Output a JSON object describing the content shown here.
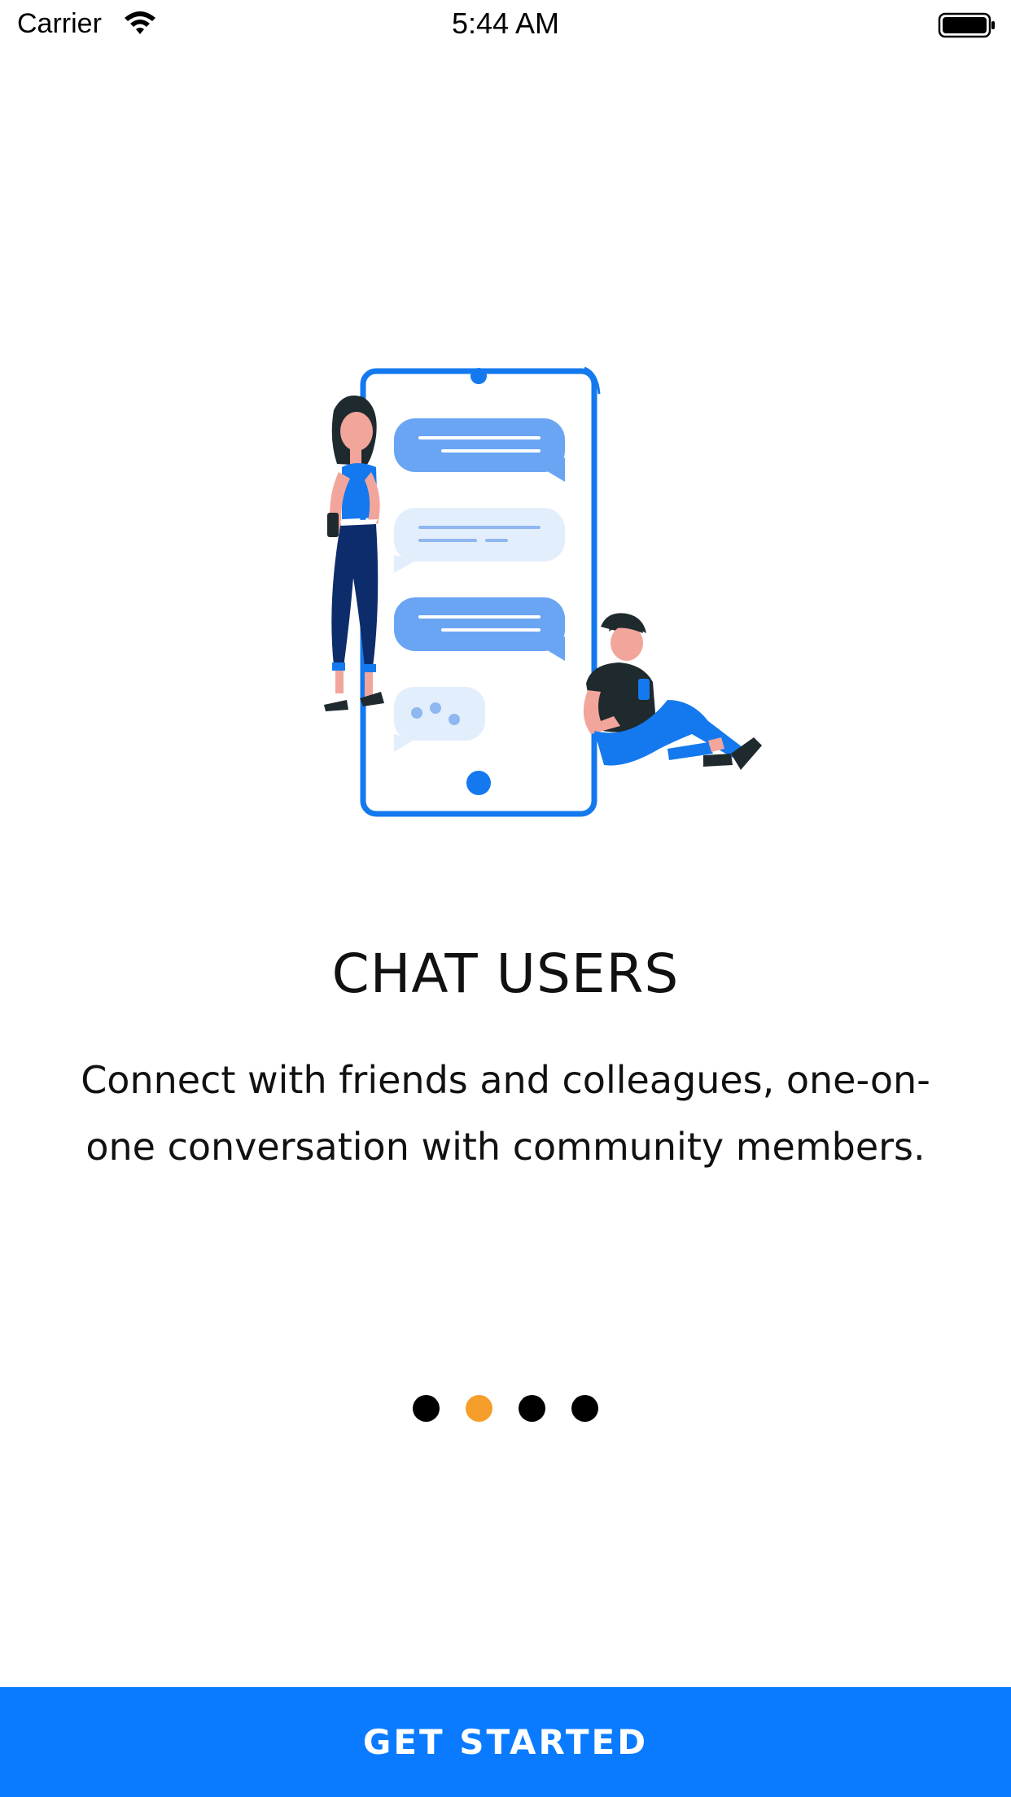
{
  "status_bar": {
    "carrier": "Carrier",
    "time": "5:44 AM",
    "wifi_icon": "wifi-icon",
    "battery_icon": "battery-icon"
  },
  "onboarding": {
    "illustration": "chat-illustration",
    "title": "CHAT USERS",
    "description": "Connect with friends and colleagues, one-on-one conversation with community members.",
    "page_count": 4,
    "active_page": 2
  },
  "cta": {
    "label": "GET STARTED"
  },
  "colors": {
    "accent": "#0A7BFF",
    "active_dot": "#F59E2B",
    "inactive_dot": "#000000"
  }
}
